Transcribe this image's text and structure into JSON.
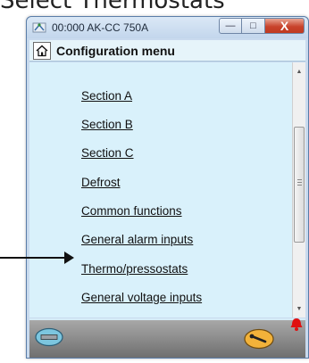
{
  "caption": "Select Thermostats",
  "window": {
    "title": "00:000 AK-CC 750A",
    "buttons": {
      "minimize": "—",
      "maximize": "□",
      "close": "X"
    }
  },
  "menubar": {
    "title": "Configuration menu"
  },
  "menu_items": [
    {
      "label": "Section A"
    },
    {
      "label": "Section B"
    },
    {
      "label": "Section C"
    },
    {
      "label": "Defrost"
    },
    {
      "label": "Common functions"
    },
    {
      "label": "General alarm inputs"
    },
    {
      "label": "Thermo/pressostats"
    },
    {
      "label": "General voltage inputs"
    }
  ],
  "icons": {
    "app": "network-icon",
    "home": "home-icon",
    "bottom_left": "keyboard-icon",
    "bottom_right": "wrench-icon",
    "alarm": "alarm-bell-icon"
  },
  "colors": {
    "content_bg": "#d9f1fb",
    "alarm": "#e01010",
    "service_button": "#f2b23a",
    "keyboard_button": "#7cc6df"
  }
}
